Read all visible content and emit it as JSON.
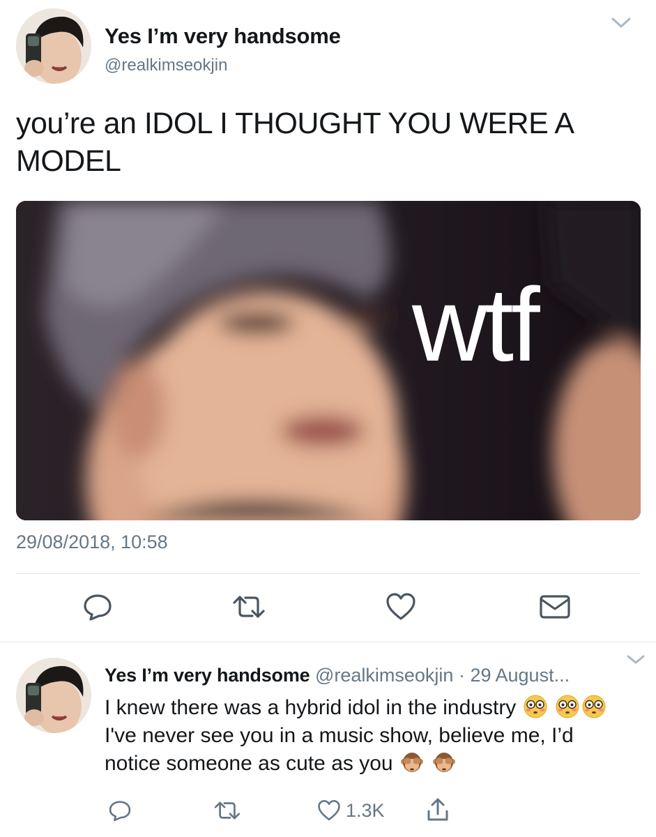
{
  "tweet": {
    "display_name": "Yes I’m very handsome",
    "handle": "@realkimseokjin",
    "text": "you’re an IDOL I THOUGHT YOU WERE A MODEL",
    "media_caption": "wtf",
    "timestamp": "29/08/2018, 10:58",
    "actions": [
      "reply-icon",
      "retweet-icon",
      "like-icon",
      "direct-message-icon"
    ]
  },
  "reply": {
    "display_name": "Yes I’m very handsome",
    "handle": "@realkimseokjin",
    "separator": "·",
    "date": "29 August...",
    "text_part1": "I knew there was a hybrid idol in the industry",
    "text_part2": "I've never see you in a music show, believe me, I’d notice someone as cute as you",
    "emojis": [
      "flushed-face-emoji",
      "flushed-face-emoji",
      "flushed-face-emoji",
      "see-no-evil-monkey-emoji",
      "see-no-evil-monkey-emoji"
    ],
    "like_count": "1.3K",
    "actions": [
      "reply-icon",
      "retweet-icon",
      "like-icon",
      "share-icon"
    ]
  },
  "colors": {
    "text_primary": "#14171a",
    "text_secondary": "#657786",
    "divider": "#dfe3e7",
    "icon": "#657786"
  }
}
